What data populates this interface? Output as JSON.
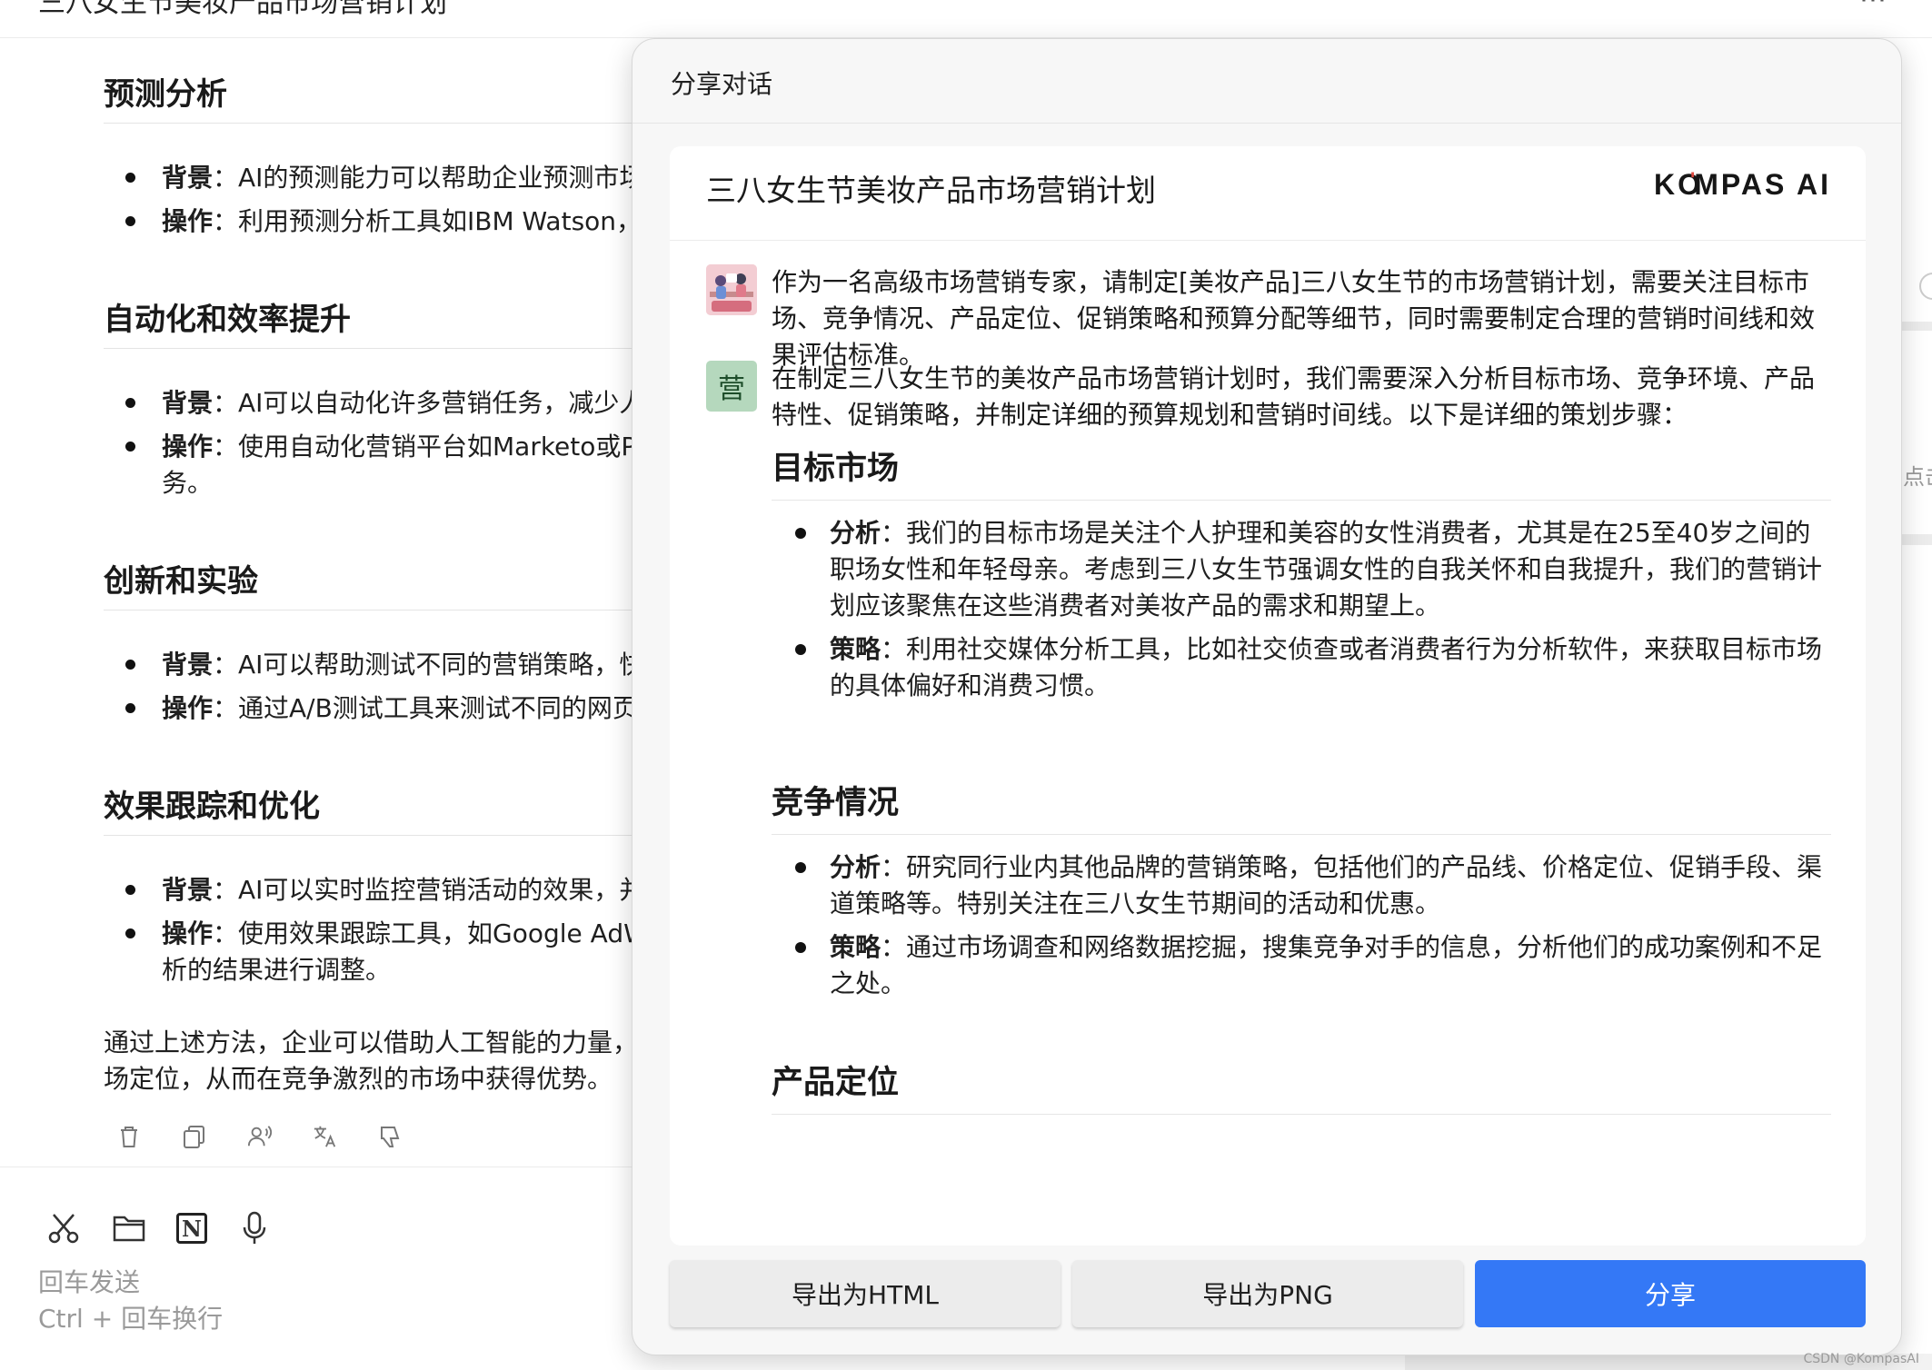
{
  "background": {
    "window_title": "三八女生节美妆产品市场营销计划",
    "window_title_partial": "三八女生节美妆产品市场营销计划",
    "sections": [
      {
        "heading": "预测分析",
        "items": [
          {
            "label": "背景",
            "text": "：AI的预测能力可以帮助企业预测市场"
          },
          {
            "label": "操作",
            "text": "：利用预测分析工具如IBM Watson，"
          }
        ]
      },
      {
        "heading": "自动化和效率提升",
        "items": [
          {
            "label": "背景",
            "text": "：AI可以自动化许多营销任务，减少人"
          },
          {
            "label": "操作",
            "text": "：使用自动化营销平台如Marketo或P",
            "cont": "务。"
          }
        ]
      },
      {
        "heading": "创新和实验",
        "items": [
          {
            "label": "背景",
            "text": "：AI可以帮助测试不同的营销策略，快"
          },
          {
            "label": "操作",
            "text": "：通过A/B测试工具来测试不同的网页"
          }
        ]
      },
      {
        "heading": "效果跟踪和优化",
        "items": [
          {
            "label": "背景",
            "text": "：AI可以实时监控营销活动的效果，并"
          },
          {
            "label": "操作",
            "text": "：使用效果跟踪工具，如Google AdW",
            "cont": "析的结果进行调整。"
          }
        ]
      }
    ],
    "conclusion": [
      "通过上述方法，企业可以借助人工智能的力量，",
      "场定位，从而在竞争激烈的市场中获得优势。"
    ],
    "action_icons": [
      "trash-icon",
      "copy-icon",
      "voice-icon",
      "translate-icon",
      "thumbs-down-icon"
    ],
    "tool_icons": [
      "scissors-icon",
      "folder-icon",
      "notion-icon",
      "microphone-icon"
    ],
    "notion_glyph": "N",
    "hint_send": "回车发送",
    "hint_newline": "Ctrl + 回车换行",
    "right_edge_text": "点击",
    "watermark": "CSDN @KompasAI"
  },
  "dialog": {
    "title": "分享对话",
    "card_title": "三八女生节美妆产品市场营销计划",
    "brand": {
      "pre": "KO",
      "accent_mark": "'",
      "post": "MPAS AI",
      "accent_color": "#e2483f"
    },
    "user_message": [
      "作为一名高级市场营销专家，请制定[美妆产品]三八女生节的市场营销计划，需要关注目标市",
      "场、竞争情况、产品定位、促销策略和预算分配等细节，同时需要制定合理的营销时间线和效",
      "果评估标准。"
    ],
    "ai_avatar_char": "营",
    "ai_intro": [
      "在制定三八女生节的美妆产品市场营销计划时，我们需要深入分析目标市场、竞争环境、产品",
      "特性、促销策略，并制定详细的预算规划和营销时间线。以下是详细的策划步骤："
    ],
    "sections": [
      {
        "heading": "目标市场",
        "items": [
          {
            "label": "分析",
            "lines": [
              "：我们的目标市场是关注个人护理和美容的女性消费者，尤其是在25至40岁之间的",
              "职场女性和年轻母亲。考虑到三八女生节强调女性的自我关怀和自我提升，我们的营销计",
              "划应该聚焦在这些消费者对美妆产品的需求和期望上。"
            ]
          },
          {
            "label": "策略",
            "lines": [
              "：利用社交媒体分析工具，比如社交侦查或者消费者行为分析软件，来获取目标市场",
              "的具体偏好和消费习惯。"
            ]
          }
        ]
      },
      {
        "heading": "竞争情况",
        "items": [
          {
            "label": "分析",
            "lines": [
              "：研究同行业内其他品牌的营销策略，包括他们的产品线、价格定位、促销手段、渠",
              "道策略等。特别关注在三八女生节期间的活动和优惠。"
            ]
          },
          {
            "label": "策略",
            "lines": [
              "：通过市场调查和网络数据挖掘，搜集竞争对手的信息，分析他们的成功案例和不足",
              "之处。"
            ]
          }
        ]
      },
      {
        "heading": "产品定位",
        "items": []
      }
    ],
    "buttons": {
      "export_html": "导出为HTML",
      "export_png": "导出为PNG",
      "share": "分享"
    },
    "share_color": "#3478f6"
  }
}
